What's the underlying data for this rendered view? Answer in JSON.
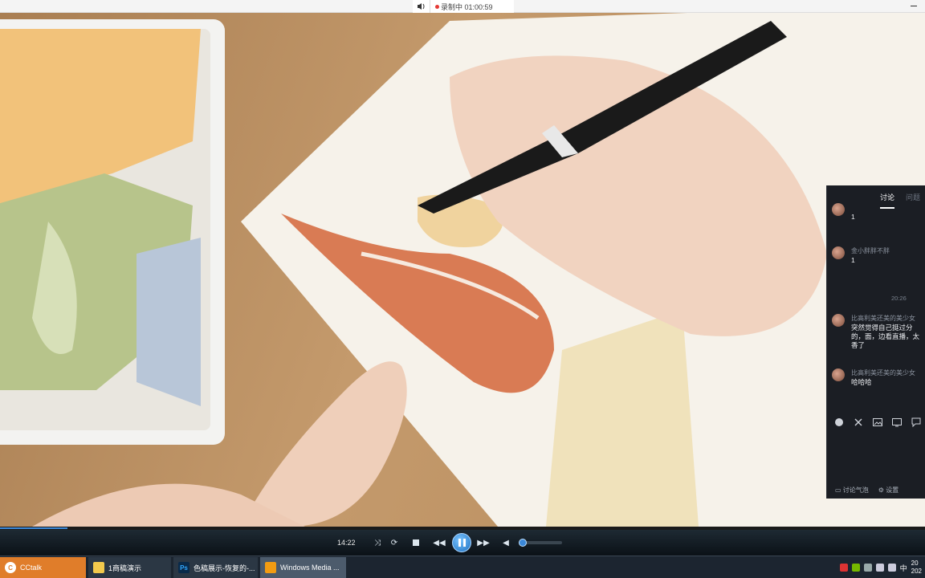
{
  "recording": {
    "status_text": "录制中 01:00:59"
  },
  "player": {
    "time": "14:22",
    "progress_fraction": 0.073,
    "volume_fraction": 0.0
  },
  "taskbar": {
    "items": [
      {
        "label": "CCtalk",
        "icon": "cctalk-icon"
      },
      {
        "label": "1商稿演示",
        "icon": "folder-icon"
      },
      {
        "label": "色稿展示-恢复的-...",
        "icon": "photoshop-icon"
      },
      {
        "label": "Windows Media ...",
        "icon": "media-player-icon"
      }
    ],
    "clock_line1": "20",
    "clock_line2": "202",
    "ime": "中"
  },
  "panel": {
    "tabs": [
      "讨论",
      "问题"
    ],
    "messages": [
      {
        "name": "",
        "text": "1"
      },
      {
        "name": "金小胖胖不胖",
        "text": "1"
      },
      {
        "name": "比高利美还美的美少女",
        "text": "突然觉得自己挺过分的，面，边看直播，太香了"
      },
      {
        "name": "比高利美还美的美少女",
        "text": "哈哈哈"
      }
    ],
    "timestamp": "20:26",
    "footer_bubble": "讨论气泡",
    "footer_settings": "设置"
  }
}
